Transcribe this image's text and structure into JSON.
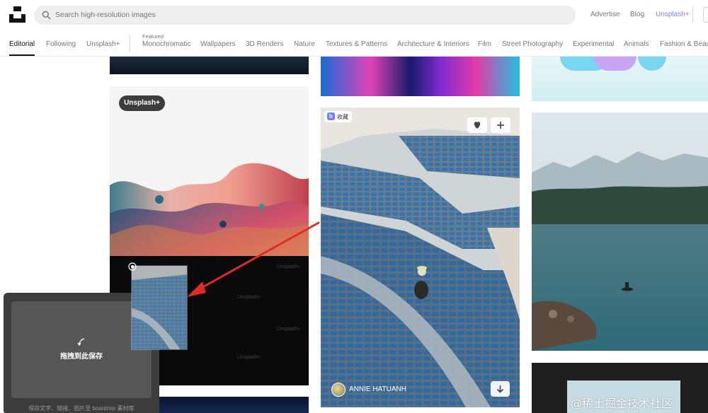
{
  "header": {
    "search_placeholder": "Search high-resolution images",
    "links": {
      "advertise": "Advertise",
      "blog": "Blog",
      "unsplash_plus": "Unsplash+"
    }
  },
  "tabs": {
    "items": [
      "Editorial",
      "Following",
      "Unsplash+",
      "Monochromatic",
      "Wallpapers",
      "3D Renders",
      "Nature",
      "Textures & Patterns",
      "Architecture & Interiors",
      "Film",
      "Street Photography",
      "Experimental",
      "Animals",
      "Fashion & Beau"
    ],
    "active": "Editorial",
    "featured_label": "Featured"
  },
  "feed": {
    "plus_badge": "Unsplash+",
    "watermark_text": "Unsplash+",
    "collect_chip": {
      "logo": "b",
      "label": "收藏"
    },
    "author_name": "ANNIE HATUANH"
  },
  "drag_overlay": {
    "drop_label": "拖拽到此保存",
    "hint": "保存文字、链接、图片至 boardmix 素材库"
  },
  "site_watermark": "@稀土掘金技术社区",
  "colors": {
    "accent_plus": "#7f7fff",
    "arrow": "#e02b2b"
  }
}
